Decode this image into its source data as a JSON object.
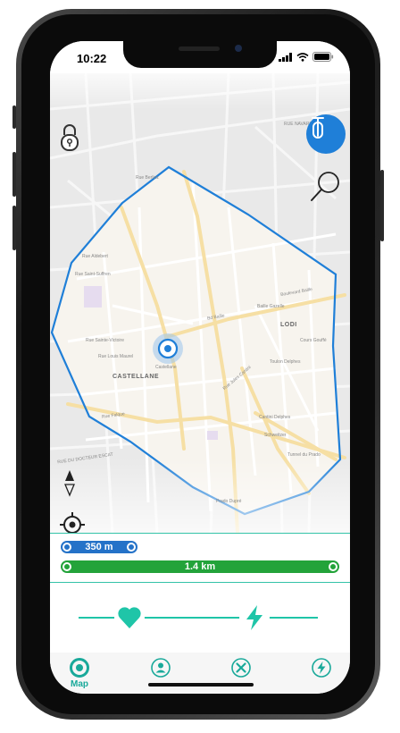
{
  "status_bar": {
    "time": "10:22"
  },
  "map": {
    "labels": {
      "district_castellane": "CASTELLANE",
      "district_lodi": "LODI",
      "rue_aldebert": "Rue Aldebert",
      "rue_saint_suffren": "Rue Saint-Suffren",
      "rue_sainte_victoire": "Rue Sainte-Victoire",
      "rue_louis_maurel": "Rue Louis Maurel",
      "rue_falque": "Rue Falque",
      "bd_docteur_escat": "RUE DU DOCTEUR ESCAT",
      "castellane_small": "Castellane",
      "bd_baille": "Bd Baille",
      "boulevard_baille": "Boulevard Baille",
      "baille_gazelle": "Baille Gazelle",
      "cours_gouffe": "Cours Gouffé",
      "toulon_delphes": "Toulon Delphes",
      "rue_jules_cantini": "Rue Jules Cantini",
      "cantini_delphes": "Cantini Delphes",
      "schweitzer": "Schweitzer",
      "tunnel_prado": "Tunnel du Prado",
      "prado_dupre": "Prado Dupré",
      "rue_berlioz": "Rue Berlioz",
      "rue_navarin": "RUE NAVARIN"
    }
  },
  "distances": {
    "walk": "350 m",
    "bike": "1.4 km"
  },
  "tabs": [
    {
      "id": "map",
      "label": "Map",
      "icon": "target-icon"
    },
    {
      "id": "profile",
      "icon": "user-icon"
    },
    {
      "id": "tools",
      "icon": "wrench-icon"
    },
    {
      "id": "energy",
      "icon": "bolt-icon"
    }
  ],
  "colors": {
    "accent": "#19a99a",
    "zone": "#1f7fd8",
    "walk": "#2472c8",
    "bike": "#23a33a",
    "heart": "#1fc5a8"
  }
}
